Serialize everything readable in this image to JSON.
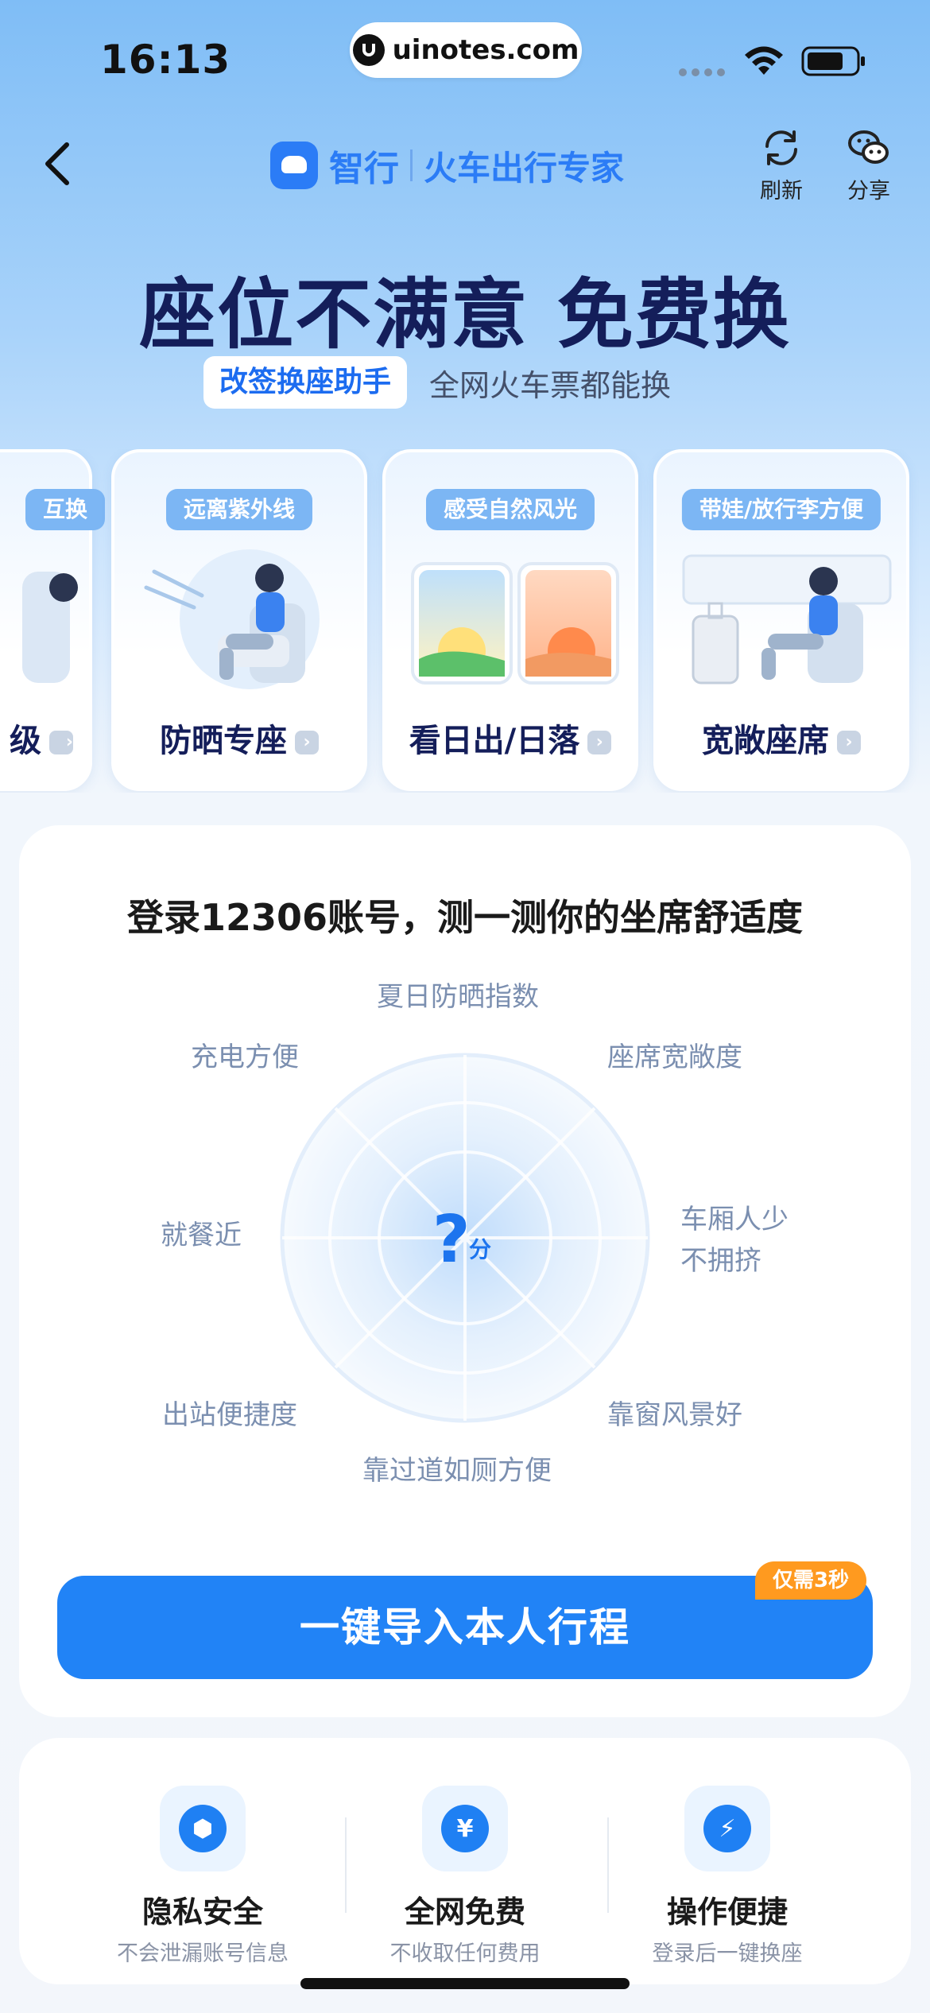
{
  "status_bar": {
    "time": "16:13",
    "url": "uinotes.com"
  },
  "nav": {
    "brand_name": "智行",
    "brand_slogan": "火车出行专家",
    "refresh_label": "刷新",
    "share_label": "分享"
  },
  "hero": {
    "title": "座位不满意 免费换",
    "badge": "改签换座助手",
    "subtitle": "全网火车票都能换"
  },
  "cards": [
    {
      "tag": "互换",
      "title": "级"
    },
    {
      "tag": "远离紫外线",
      "title": "防晒专座"
    },
    {
      "tag": "感受自然风光",
      "title": "看日出/日落"
    },
    {
      "tag": "带娃/放行李方便",
      "title": "宽敞座席"
    }
  ],
  "comfort": {
    "title": "登录12306账号，测一测你的坐席舒适度",
    "labels": {
      "top": "夏日防晒指数",
      "top_right": "座席宽敞度",
      "right": "车厢人少\n不拥挤",
      "bottom_right": "靠窗风景好",
      "bottom": "靠过道如厕方便",
      "bottom_left": "出站便捷度",
      "left": "就餐近",
      "top_left": "充电方便"
    },
    "score": "?",
    "score_unit": "分",
    "cta_label": "一键导入本人行程",
    "cta_badge": "仅需3秒"
  },
  "benefits": [
    {
      "icon": "shield-icon",
      "glyph": "⬢",
      "title": "隐私安全",
      "desc": "不会泄漏账号信息"
    },
    {
      "icon": "yen-icon",
      "glyph": "¥",
      "title": "全网免费",
      "desc": "不收取任何费用"
    },
    {
      "icon": "lightning-icon",
      "glyph": "⚡",
      "title": "操作便捷",
      "desc": "登录后一键换座"
    }
  ],
  "colors": {
    "primary": "#2183f6",
    "title_navy": "#141e5a",
    "badge_orange": "#ff9a1f"
  }
}
